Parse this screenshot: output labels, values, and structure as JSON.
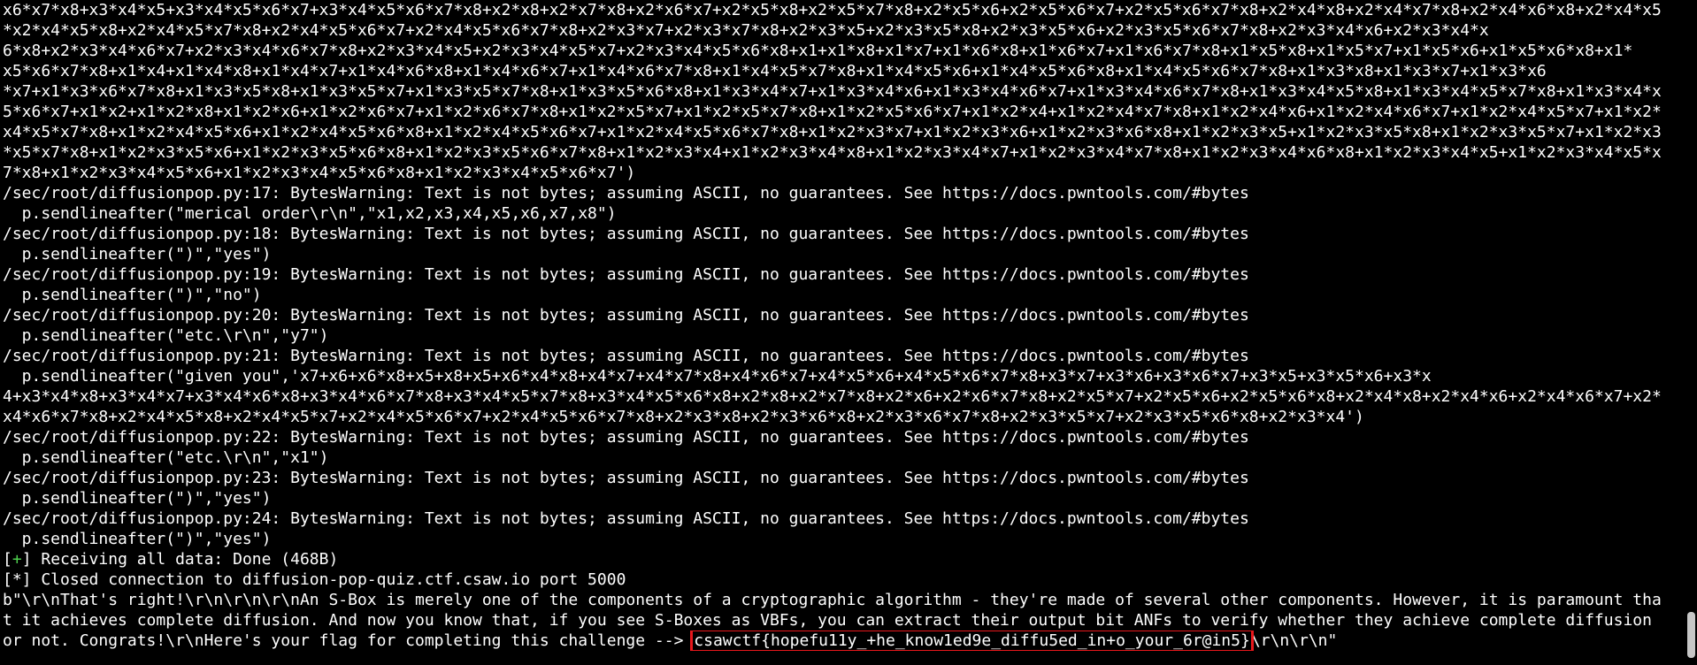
{
  "terminal": {
    "lines": [
      "x6*x7*x8+x3*x4*x5+x3*x4*x5*x6*x7+x3*x4*x5*x6*x7*x8+x2*x8+x2*x7*x8+x2*x6*x7+x2*x5*x8+x2*x5*x7*x8+x2*x5*x6+x2*x5*x6*x7+x2*x5*x6*x7*x8+x2*x4*x8+x2*x4*x7*x8+x2*x4*x6*x8+x2*x4*x5",
      "*x2*x4*x5*x8+x2*x4*x5*x7*x8+x2*x4*x5*x6*x7+x2*x4*x5*x6*x7*x8+x2*x3*x7+x2*x3*x7*x8+x2*x3*x5+x2*x3*x5*x8+x2*x3*x5*x6+x2*x3*x5*x6*x7*x8+x2*x3*x4*x6+x2*x3*x4*x",
      "6*x8+x2*x3*x4*x6*x7+x2*x3*x4*x6*x7*x8+x2*x3*x4*x5+x2*x3*x4*x5*x7+x2*x3*x4*x5*x6*x8+x1+x1*x8+x1*x7+x1*x6*x8+x1*x6*x7+x1*x6*x7*x8+x1*x5*x8+x1*x5*x7+x1*x5*x6+x1*x5*x6*x8+x1*",
      "x5*x6*x7*x8+x1*x4+x1*x4*x8+x1*x4*x7+x1*x4*x6*x8+x1*x4*x6*x7+x1*x4*x6*x7*x8+x1*x4*x5*x7*x8+x1*x4*x5*x6+x1*x4*x5*x6*x8+x1*x4*x5*x6*x7*x8+x1*x3*x8+x1*x3*x7+x1*x3*x6",
      "*x7+x1*x3*x6*x7*x8+x1*x3*x5*x8+x1*x3*x5*x7+x1*x3*x5*x7*x8+x1*x3*x5*x6*x8+x1*x3*x4*x7+x1*x3*x4*x6+x1*x3*x4*x6*x7+x1*x3*x4*x6*x7*x8+x1*x3*x4*x5*x8+x1*x3*x4*x5*x7*x8+x1*x3*x4*x",
      "5*x6*x7+x1*x2+x1*x2*x8+x1*x2*x6+x1*x2*x6*x7+x1*x2*x6*x7*x8+x1*x2*x5*x7+x1*x2*x5*x7*x8+x1*x2*x5*x6*x7+x1*x2*x4+x1*x2*x4*x7*x8+x1*x2*x4*x6+x1*x2*x4*x6*x7+x1*x2*x4*x5*x7+x1*x2*",
      "x4*x5*x7*x8+x1*x2*x4*x5*x6+x1*x2*x4*x5*x6*x8+x1*x2*x4*x5*x6*x7+x1*x2*x4*x5*x6*x7*x8+x1*x2*x3*x7+x1*x2*x3*x6+x1*x2*x3*x6*x8+x1*x2*x3*x5+x1*x2*x3*x5*x8+x1*x2*x3*x5*x7+x1*x2*x3",
      "*x5*x7*x8+x1*x2*x3*x5*x6+x1*x2*x3*x5*x6*x8+x1*x2*x3*x5*x6*x7*x8+x1*x2*x3*x4+x1*x2*x3*x4*x8+x1*x2*x3*x4*x7+x1*x2*x3*x4*x7*x8+x1*x2*x3*x4*x6*x8+x1*x2*x3*x4*x5+x1*x2*x3*x4*x5*x",
      "7*x8+x1*x2*x3*x4*x5*x6+x1*x2*x3*x4*x5*x6*x8+x1*x2*x3*x4*x5*x6*x7')",
      "/sec/root/diffusionpop.py:17: BytesWarning: Text is not bytes; assuming ASCII, no guarantees. See https://docs.pwntools.com/#bytes",
      "  p.sendlineafter(\"merical order\\r\\n\",\"x1,x2,x3,x4,x5,x6,x7,x8\")",
      "/sec/root/diffusionpop.py:18: BytesWarning: Text is not bytes; assuming ASCII, no guarantees. See https://docs.pwntools.com/#bytes",
      "  p.sendlineafter(\")\",\"yes\")",
      "/sec/root/diffusionpop.py:19: BytesWarning: Text is not bytes; assuming ASCII, no guarantees. See https://docs.pwntools.com/#bytes",
      "  p.sendlineafter(\")\",\"no\")",
      "/sec/root/diffusionpop.py:20: BytesWarning: Text is not bytes; assuming ASCII, no guarantees. See https://docs.pwntools.com/#bytes",
      "  p.sendlineafter(\"etc.\\r\\n\",\"y7\")",
      "/sec/root/diffusionpop.py:21: BytesWarning: Text is not bytes; assuming ASCII, no guarantees. See https://docs.pwntools.com/#bytes",
      "  p.sendlineafter(\"given you\",'x7+x6+x6*x8+x5+x8+x5+x6*x4*x8+x4*x7+x4*x7*x8+x4*x6*x7+x4*x5*x6+x4*x5*x6*x7*x8+x3*x7+x3*x6+x3*x6*x7+x3*x5+x3*x5*x6+x3*x",
      "4+x3*x4*x8+x3*x4*x7+x3*x4*x6*x8+x3*x4*x6*x7*x8+x3*x4*x5*x7*x8+x3*x4*x5*x6*x8+x2*x8+x2*x7*x8+x2*x6+x2*x6*x7*x8+x2*x5*x7+x2*x5*x6+x2*x5*x6*x8+x2*x4*x8+x2*x4*x6+x2*x4*x6*x7+x2*",
      "x4*x6*x7*x8+x2*x4*x5*x8+x2*x4*x5*x7+x2*x4*x5*x6*x7+x2*x4*x5*x6*x7*x8+x2*x3*x8+x2*x3*x6*x8+x2*x3*x6*x7*x8+x2*x3*x5*x7+x2*x3*x5*x6*x8+x2*x3*x4')",
      "/sec/root/diffusionpop.py:22: BytesWarning: Text is not bytes; assuming ASCII, no guarantees. See https://docs.pwntools.com/#bytes",
      "  p.sendlineafter(\"etc.\\r\\n\",\"x1\")",
      "/sec/root/diffusionpop.py:23: BytesWarning: Text is not bytes; assuming ASCII, no guarantees. See https://docs.pwntools.com/#bytes",
      "  p.sendlineafter(\")\",\"yes\")",
      "/sec/root/diffusionpop.py:24: BytesWarning: Text is not bytes; assuming ASCII, no guarantees. See https://docs.pwntools.com/#bytes",
      "  p.sendlineafter(\")\",\"yes\")"
    ],
    "receiving": {
      "bracket_open": "[",
      "marker": "+",
      "bracket_close": "]",
      "text": " Receiving all data: Done (468B)"
    },
    "closed_line": "[*] Closed connection to diffusion-pop-quiz.ctf.csaw.io port 5000",
    "output_line_1": "b\"\\r\\nThat's right!\\r\\n\\r\\n\\r\\nAn S-Box is merely one of the components of a cryptographic algorithm - they're made of several other components. However, it is paramount tha",
    "output_line_2": "t it achieves complete diffusion. And now you know that, if you see S-Boxes as VBFs, you can extract their output bit ANFs to verify whether they achieve complete diffusion",
    "output_line_3_prefix": "or not. Congrats!\\r\\nHere's your flag for completing this challenge --> ",
    "flag": "csawctf{hopefu11y_+he_know1ed9e_diffu5ed_in+o_your_6r@in5}",
    "output_line_3_suffix": "\\r\\n\\r\\n\""
  },
  "colors": {
    "background": "#000000",
    "foreground": "#ffffff",
    "success_marker": "#4fd14f",
    "flag_highlight": "#e8171b",
    "scrollbar_thumb": "#c7c7c7"
  }
}
